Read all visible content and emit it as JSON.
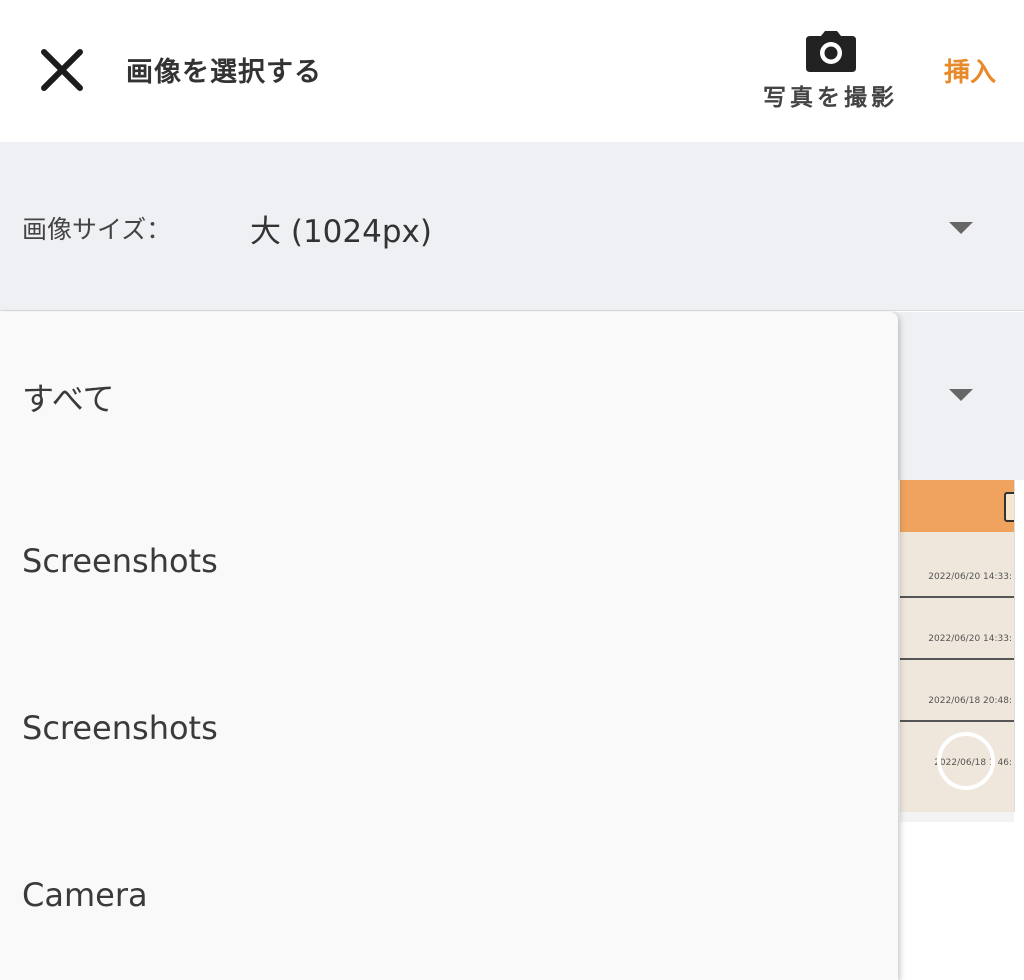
{
  "header": {
    "title": "画像を選択する",
    "camera_label": "写真を撮影",
    "insert_label": "挿入"
  },
  "size": {
    "label": "画像サイズ：",
    "value": "大 (1024px)"
  },
  "album_options": [
    "すべて",
    "Screenshots",
    "Screenshots",
    "Camera"
  ],
  "thumbnail": {
    "dates": [
      "2022/06/20 14:33:",
      "2022/06/20 14:33:",
      "2022/06/18 20:48:",
      "2022/06/18 1  46:"
    ]
  },
  "colors": {
    "accent": "#e8892a",
    "panel_bg": "#eef0f3",
    "dropdown_bg": "#f9f9f9"
  },
  "icons": {
    "close": "close-icon",
    "camera": "camera-icon",
    "dropdown": "triangle-down-icon"
  }
}
